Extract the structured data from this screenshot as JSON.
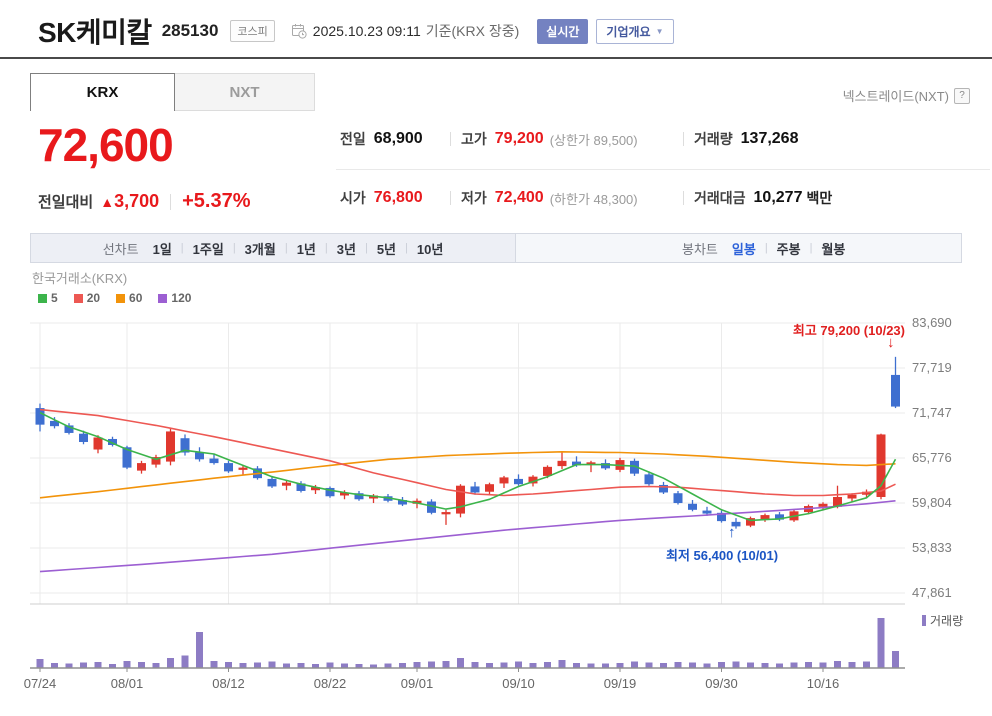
{
  "header": {
    "title": "SK케미칼",
    "code": "285130",
    "market_badge": "코스피",
    "datetime": "2025.10.23 09:11",
    "datetime_suffix": "기준(KRX 장중)",
    "realtime_button": "실시간",
    "overview_button": "기업개요",
    "overview_caret": "▼"
  },
  "tabs": {
    "krx": "KRX",
    "nxt": "NXT",
    "nxt_note": "넥스트레이드(NXT)",
    "help_icon": "?"
  },
  "quote": {
    "current_price": "72,600",
    "change_label": "전일대비",
    "change_arrow": "▲",
    "change_value": "3,700",
    "change_percent": "+5.37%",
    "stats_rows": [
      {
        "c1_label": "전일",
        "c1_value": "68,900",
        "c2_label": "고가",
        "c2_value": "79,200",
        "c2_sub": "(상한가 89,500)",
        "c3_label": "거래량",
        "c3_value": "137,268",
        "c3_suffix": ""
      },
      {
        "c1_label": "시가",
        "c1_value": "76,800",
        "c2_label": "저가",
        "c2_value": "72,400",
        "c2_sub": "(하한가 48,300)",
        "c3_label": "거래대금",
        "c3_value": "10,277",
        "c3_suffix": "백만"
      }
    ]
  },
  "toolbar": {
    "line_chart_label": "선차트",
    "periods": [
      "1일",
      "1주일",
      "3개월",
      "1년",
      "3년",
      "5년",
      "10년"
    ],
    "candle_chart_label": "봉차트",
    "candle_types": [
      {
        "label": "일봉",
        "selected": true
      },
      {
        "label": "주봉",
        "selected": false
      },
      {
        "label": "월봉",
        "selected": false
      }
    ]
  },
  "chart": {
    "source": "한국거래소(KRX)",
    "ma_legend": [
      {
        "label": "5",
        "color": "#3cb44b"
      },
      {
        "label": "20",
        "color": "#ed5853"
      },
      {
        "label": "60",
        "color": "#f2930a"
      },
      {
        "label": "120",
        "color": "#9c5fd2"
      }
    ],
    "volume_legend": "거래량",
    "high_annotation": "최고 79,200 (10/23)",
    "high_arrow": "↓",
    "low_annotation": "최저 56,400 (10/01)",
    "low_arrow": "↑"
  },
  "chart_data": {
    "type": "candlestick",
    "title": "SK케미칼 일봉 차트 (KRX)",
    "y_axis": {
      "ticks": [
        {
          "label": "83,690",
          "value": 83690
        },
        {
          "label": "77,719",
          "value": 77719
        },
        {
          "label": "71,747",
          "value": 71747
        },
        {
          "label": "65,776",
          "value": 65776
        },
        {
          "label": "59,804",
          "value": 59804
        },
        {
          "label": "53,833",
          "value": 53833
        },
        {
          "label": "47,861",
          "value": 47861
        }
      ]
    },
    "x_axis": {
      "ticks": [
        {
          "label": "07/24",
          "index": 0
        },
        {
          "label": "08/01",
          "index": 6
        },
        {
          "label": "08/12",
          "index": 13
        },
        {
          "label": "08/22",
          "index": 20
        },
        {
          "label": "09/01",
          "index": 26
        },
        {
          "label": "09/10",
          "index": 33
        },
        {
          "label": "09/19",
          "index": 40
        },
        {
          "label": "09/30",
          "index": 47
        },
        {
          "label": "10/16",
          "index": 54
        }
      ]
    },
    "annotations": {
      "high": {
        "value": 79200,
        "date": "10/23"
      },
      "low": {
        "value": 56400,
        "date": "10/01"
      }
    },
    "candle_format": [
      "date",
      "open",
      "high",
      "low",
      "close",
      "volume_rel_pct"
    ],
    "candles": [
      [
        "07/24",
        72400,
        73000,
        69300,
        70200,
        18
      ],
      [
        "07/25",
        70700,
        71200,
        69700,
        70000,
        10
      ],
      [
        "07/28",
        70100,
        70400,
        68900,
        69100,
        9
      ],
      [
        "07/29",
        69000,
        69400,
        67600,
        67900,
        11
      ],
      [
        "07/30",
        66900,
        68800,
        66400,
        68500,
        12
      ],
      [
        "07/31",
        68300,
        68600,
        67300,
        67500,
        8
      ],
      [
        "08/01",
        67200,
        67400,
        64300,
        64500,
        14
      ],
      [
        "08/04",
        64100,
        65400,
        63700,
        65100,
        12
      ],
      [
        "08/05",
        64900,
        66200,
        64500,
        65900,
        10
      ],
      [
        "08/06",
        65300,
        69700,
        64800,
        69300,
        20
      ],
      [
        "08/07",
        68400,
        68900,
        66100,
        66500,
        25
      ],
      [
        "08/08",
        66500,
        67200,
        65300,
        65600,
        72
      ],
      [
        "08/11",
        65700,
        66300,
        64900,
        65100,
        14
      ],
      [
        "08/12",
        65100,
        65400,
        63800,
        64000,
        12
      ],
      [
        "08/13",
        64200,
        64800,
        63500,
        64500,
        10
      ],
      [
        "08/14",
        64400,
        64700,
        62900,
        63100,
        11
      ],
      [
        "08/18",
        63000,
        63400,
        61800,
        62000,
        13
      ],
      [
        "08/19",
        62100,
        62800,
        61500,
        62500,
        9
      ],
      [
        "08/20",
        62400,
        62700,
        61200,
        61400,
        10
      ],
      [
        "08/21",
        61500,
        62200,
        61000,
        61900,
        8
      ],
      [
        "08/22",
        61800,
        62000,
        60500,
        60700,
        11
      ],
      [
        "08/25",
        60800,
        61500,
        60300,
        61200,
        9
      ],
      [
        "08/26",
        61100,
        61400,
        60100,
        60300,
        8
      ],
      [
        "08/27",
        60400,
        61000,
        59800,
        60800,
        7
      ],
      [
        "08/28",
        60700,
        61000,
        59900,
        60100,
        9
      ],
      [
        "08/29",
        60200,
        60600,
        59400,
        59600,
        10
      ],
      [
        "09/01",
        59700,
        60400,
        59100,
        60100,
        12
      ],
      [
        "09/02",
        60000,
        60300,
        58300,
        58500,
        13
      ],
      [
        "09/03",
        58300,
        58900,
        56900,
        58600,
        14
      ],
      [
        "09/04",
        58400,
        62300,
        57900,
        62100,
        20
      ],
      [
        "09/05",
        62000,
        62600,
        60900,
        61200,
        12
      ],
      [
        "09/08",
        61300,
        62500,
        61000,
        62300,
        10
      ],
      [
        "09/09",
        62400,
        63400,
        61800,
        63200,
        11
      ],
      [
        "09/10",
        63000,
        63600,
        62100,
        62300,
        13
      ],
      [
        "09/11",
        62400,
        63500,
        62000,
        63300,
        10
      ],
      [
        "09/12",
        63400,
        64800,
        63100,
        64600,
        12
      ],
      [
        "09/15",
        64700,
        66700,
        64300,
        65400,
        16
      ],
      [
        "09/16",
        65300,
        66000,
        64600,
        64800,
        10
      ],
      [
        "09/17",
        64900,
        65400,
        63900,
        65200,
        9
      ],
      [
        "09/18",
        65100,
        65600,
        64200,
        64400,
        9
      ],
      [
        "09/19",
        64200,
        65800,
        63900,
        65500,
        10
      ],
      [
        "09/22",
        65400,
        65700,
        63400,
        63700,
        13
      ],
      [
        "09/23",
        63600,
        64000,
        62100,
        62300,
        11
      ],
      [
        "09/24",
        62200,
        62600,
        61000,
        61200,
        10
      ],
      [
        "09/25",
        61100,
        61400,
        59600,
        59800,
        12
      ],
      [
        "09/26",
        59700,
        60200,
        58700,
        58900,
        11
      ],
      [
        "09/29",
        58800,
        59300,
        58100,
        58400,
        9
      ],
      [
        "09/30",
        58500,
        58800,
        57200,
        57400,
        12
      ],
      [
        "10/01",
        57300,
        57800,
        56400,
        56700,
        13
      ],
      [
        "10/02",
        56800,
        58000,
        56600,
        57800,
        11
      ],
      [
        "10/10",
        57600,
        58400,
        57300,
        58200,
        10
      ],
      [
        "10/13",
        58300,
        58600,
        57400,
        57600,
        9
      ],
      [
        "10/14",
        57500,
        58900,
        57300,
        58700,
        11
      ],
      [
        "10/15",
        58600,
        59600,
        58300,
        59400,
        12
      ],
      [
        "10/16",
        59300,
        59900,
        58800,
        59700,
        11
      ],
      [
        "10/17",
        59300,
        62100,
        59100,
        60600,
        14
      ],
      [
        "10/20",
        60400,
        61100,
        59900,
        60900,
        12
      ],
      [
        "10/21",
        60900,
        61600,
        60400,
        61300,
        13
      ],
      [
        "10/22",
        60600,
        69000,
        60300,
        68900,
        100
      ],
      [
        "10/23",
        76800,
        79200,
        72400,
        72600,
        34
      ]
    ],
    "moving_averages": {
      "ma5": {
        "color": "#3cb44b",
        "points": [
          [
            0,
            71800
          ],
          [
            2,
            69900
          ],
          [
            4,
            68600
          ],
          [
            6,
            66900
          ],
          [
            8,
            65600
          ],
          [
            10,
            66800
          ],
          [
            12,
            66300
          ],
          [
            14,
            64800
          ],
          [
            16,
            63300
          ],
          [
            18,
            62300
          ],
          [
            20,
            61500
          ],
          [
            22,
            60900
          ],
          [
            24,
            60500
          ],
          [
            26,
            59800
          ],
          [
            28,
            59000
          ],
          [
            29,
            59300
          ],
          [
            31,
            60300
          ],
          [
            33,
            62000
          ],
          [
            35,
            63300
          ],
          [
            37,
            64900
          ],
          [
            39,
            64900
          ],
          [
            41,
            64700
          ],
          [
            43,
            63100
          ],
          [
            45,
            61000
          ],
          [
            47,
            58900
          ],
          [
            49,
            57500
          ],
          [
            51,
            57700
          ],
          [
            53,
            58400
          ],
          [
            55,
            59400
          ],
          [
            57,
            60500
          ],
          [
            58,
            62100
          ],
          [
            59,
            65600
          ]
        ]
      },
      "ma20": {
        "color": "#ed5853",
        "points": [
          [
            0,
            72200
          ],
          [
            4,
            71400
          ],
          [
            8,
            70100
          ],
          [
            12,
            68600
          ],
          [
            16,
            67000
          ],
          [
            20,
            65400
          ],
          [
            23,
            63800
          ],
          [
            26,
            62500
          ],
          [
            28,
            61600
          ],
          [
            30,
            61000
          ],
          [
            32,
            60800
          ],
          [
            34,
            61000
          ],
          [
            36,
            61300
          ],
          [
            38,
            61600
          ],
          [
            40,
            61900
          ],
          [
            42,
            62000
          ],
          [
            44,
            61900
          ],
          [
            46,
            61600
          ],
          [
            48,
            61300
          ],
          [
            50,
            61000
          ],
          [
            52,
            60800
          ],
          [
            54,
            60800
          ],
          [
            56,
            61000
          ],
          [
            58,
            61400
          ],
          [
            59,
            62300
          ]
        ]
      },
      "ma60": {
        "color": "#f2930a",
        "points": [
          [
            0,
            60500
          ],
          [
            4,
            61300
          ],
          [
            8,
            62200
          ],
          [
            12,
            63100
          ],
          [
            16,
            63900
          ],
          [
            20,
            64800
          ],
          [
            24,
            65600
          ],
          [
            28,
            66100
          ],
          [
            32,
            66400
          ],
          [
            36,
            66600
          ],
          [
            40,
            66500
          ],
          [
            43,
            66300
          ],
          [
            46,
            66000
          ],
          [
            49,
            65600
          ],
          [
            52,
            65200
          ],
          [
            55,
            64900
          ],
          [
            57,
            64800
          ],
          [
            59,
            65000
          ]
        ]
      },
      "ma120": {
        "color": "#9c5fd2",
        "points": [
          [
            0,
            50700
          ],
          [
            8,
            51800
          ],
          [
            16,
            53000
          ],
          [
            24,
            54600
          ],
          [
            32,
            56200
          ],
          [
            40,
            57500
          ],
          [
            46,
            58200
          ],
          [
            50,
            58700
          ],
          [
            54,
            59200
          ],
          [
            57,
            59700
          ],
          [
            59,
            60100
          ]
        ]
      }
    },
    "colors": {
      "up": "#e0382e",
      "down": "#3e6fd0",
      "volume": "#8d7cc4",
      "grid": "#ebebeb",
      "grid_border": "#cfcfcf",
      "axis": "#8f8f8f"
    }
  }
}
